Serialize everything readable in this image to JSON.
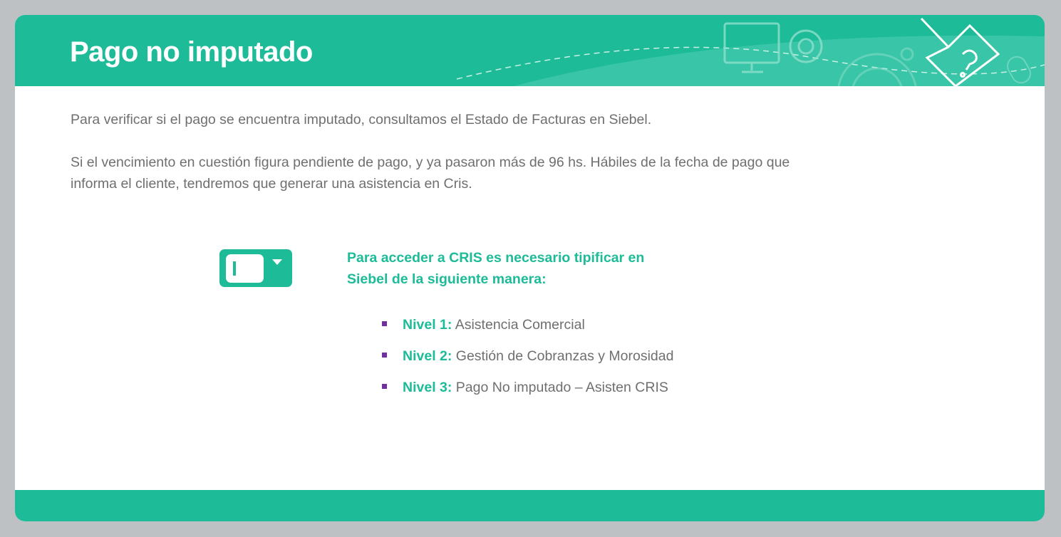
{
  "header": {
    "title": "Pago no imputado"
  },
  "body": {
    "paragraph1": "Para verificar si el pago se encuentra imputado, consultamos el Estado de Facturas en Siebel.",
    "paragraph2_line1": "Si el vencimiento en cuestión figura pendiente de pago, y ya pasaron más de 96 hs. Hábiles de la fecha de pago que",
    "paragraph2_line2": "informa el cliente, tendremos que generar una asistencia en Cris."
  },
  "instructions": {
    "heading_line1": "Para acceder a CRIS es necesario tipificar en",
    "heading_line2": "Siebel de la siguiente manera:",
    "levels": [
      {
        "label": "Nivel 1:",
        "value": "Asistencia Comercial"
      },
      {
        "label": "Nivel 2:",
        "value": "Gestión de Cobranzas y Morosidad"
      },
      {
        "label": "Nivel 3:",
        "value": "Pago No imputado – Asisten CRIS"
      }
    ]
  },
  "colors": {
    "accent": "#1dbb98",
    "bullet": "#7030a0",
    "text": "#6f6f6f"
  }
}
